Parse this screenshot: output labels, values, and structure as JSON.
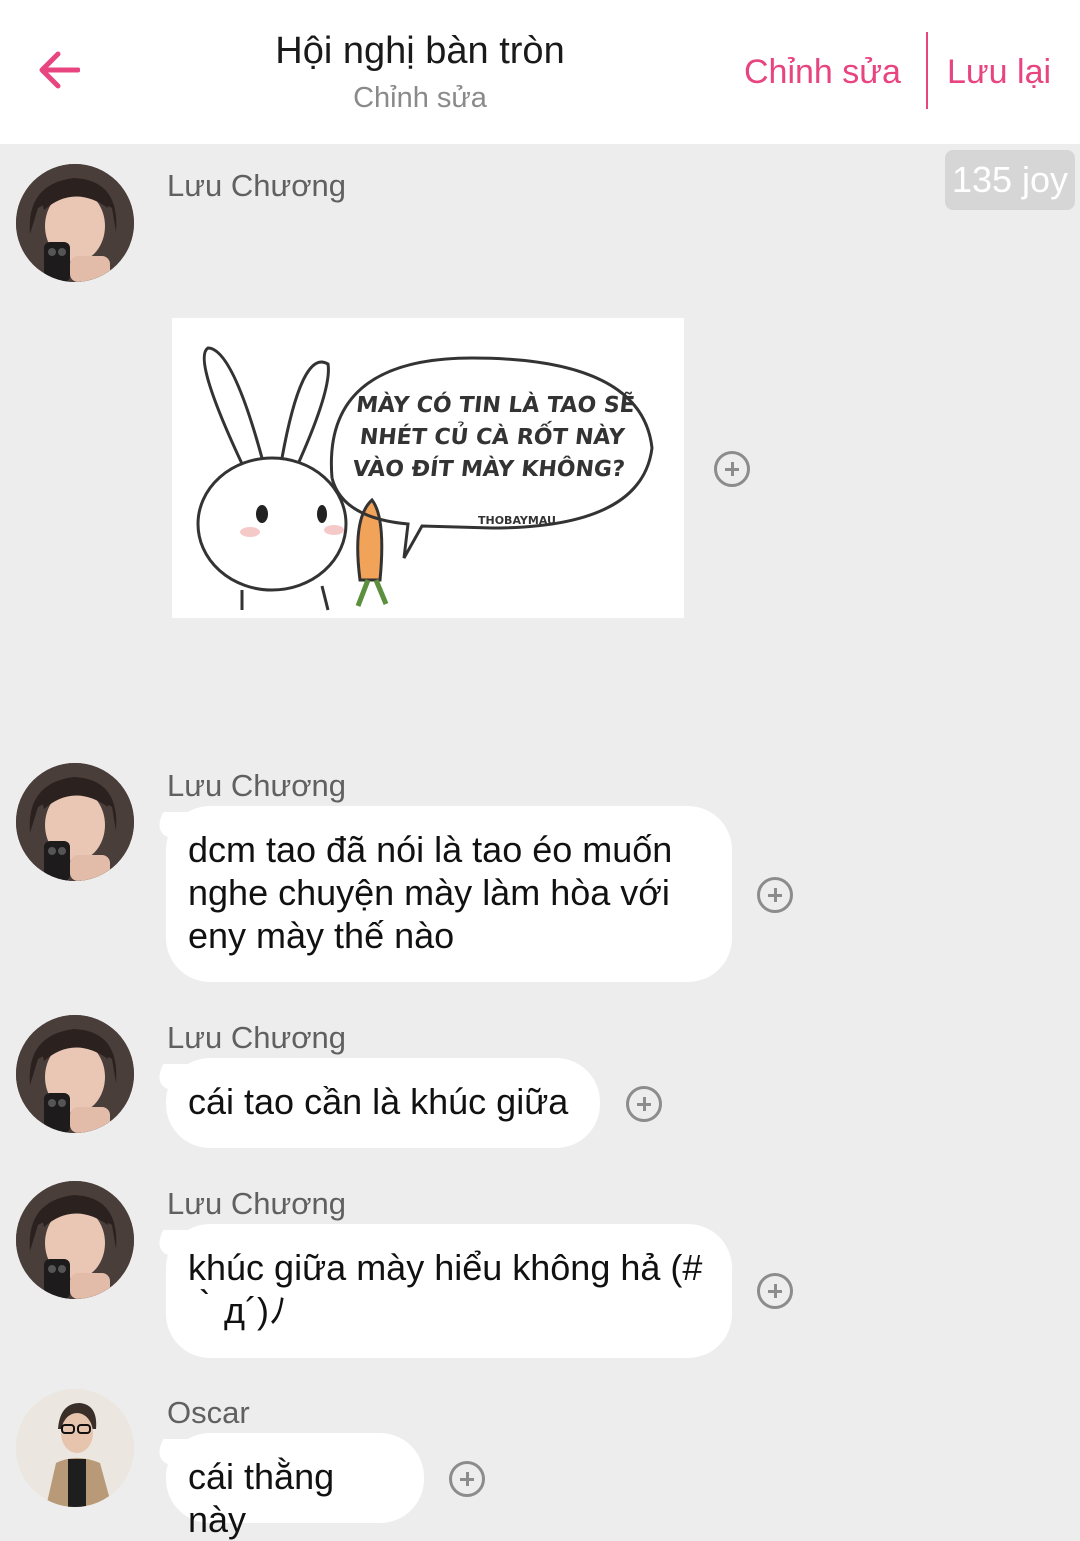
{
  "header": {
    "title": "Hội nghị bàn tròn",
    "subtitle": "Chỉnh sửa",
    "edit_label": "Chỉnh sửa",
    "save_label": "Lưu lại",
    "accent_color": "#e8447f"
  },
  "badge": {
    "text": "135 joy"
  },
  "messages": [
    {
      "sender": "Lưu Chương",
      "type": "sticker",
      "sticker_text": "MÀY CÓ TIN LÀ TAO SẼ NHÉT CỦ CÀ RỐT NÀY VÀO ĐÍT MÀY KHÔNG?",
      "sticker_tag": "THOBAYMAU"
    },
    {
      "sender": "Lưu Chương",
      "type": "text",
      "text": "dcm tao đã nói là tao éo muốn nghe chuyện mày làm hòa với eny mày thế nào"
    },
    {
      "sender": "Lưu Chương",
      "type": "text",
      "text": "cái tao cần là khúc giữa"
    },
    {
      "sender": "Lưu Chương",
      "type": "text",
      "text": "khúc giữa mày hiểu không hả (#｀д´)ﾉ"
    },
    {
      "sender": "Oscar",
      "type": "text",
      "text": "cái thằng này"
    }
  ]
}
